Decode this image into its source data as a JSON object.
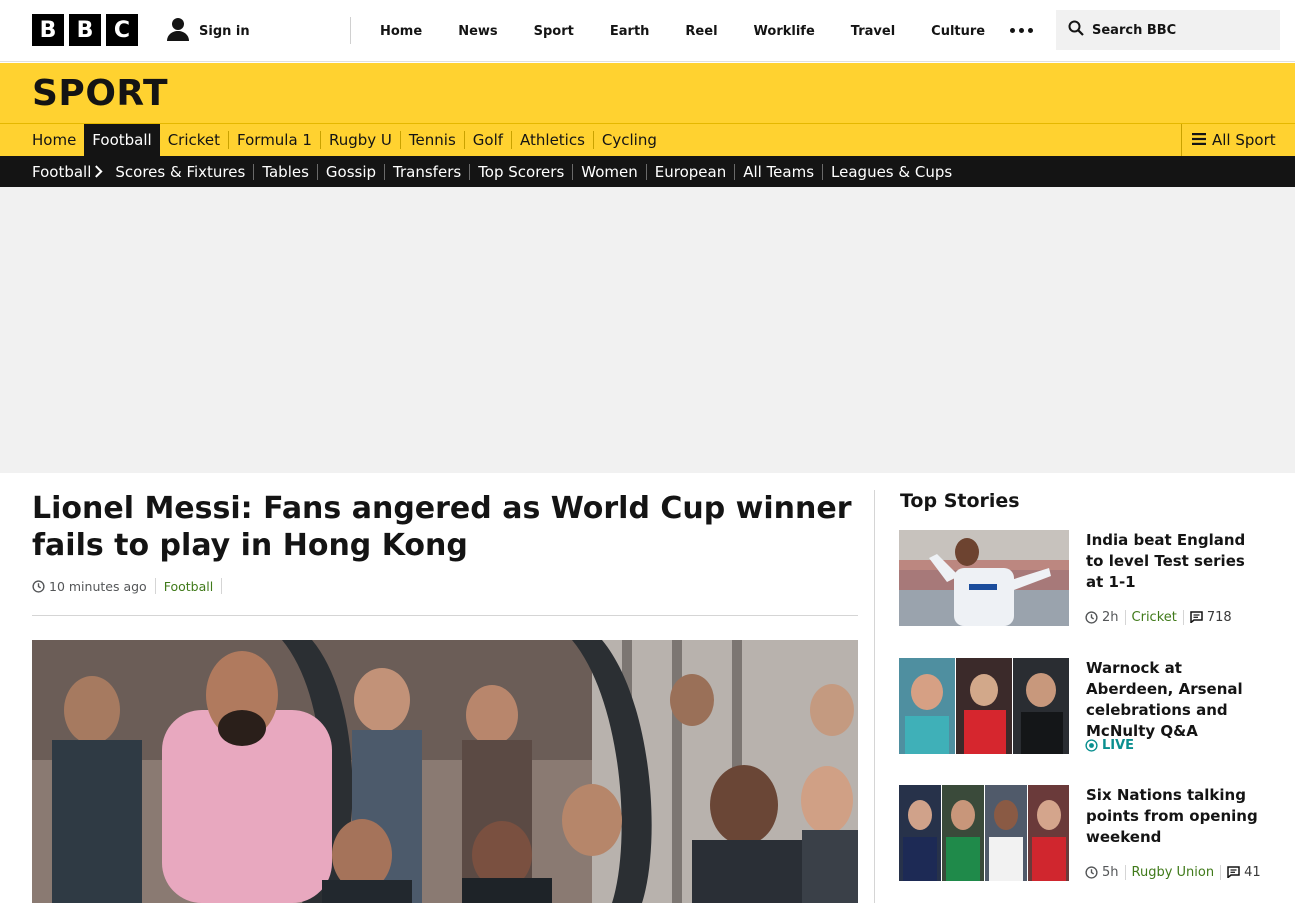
{
  "masthead": {
    "logo_letters": [
      "B",
      "B",
      "C"
    ],
    "signin_label": "Sign in",
    "nav": [
      "Home",
      "News",
      "Sport",
      "Earth",
      "Reel",
      "Worklife",
      "Travel",
      "Culture"
    ],
    "search_placeholder": "Search BBC"
  },
  "sport": {
    "title": "SPORT",
    "nav": [
      {
        "label": "Home",
        "active": false
      },
      {
        "label": "Football",
        "active": true
      },
      {
        "label": "Cricket",
        "active": false
      },
      {
        "label": "Formula 1",
        "active": false
      },
      {
        "label": "Rugby U",
        "active": false
      },
      {
        "label": "Tennis",
        "active": false
      },
      {
        "label": "Golf",
        "active": false
      },
      {
        "label": "Athletics",
        "active": false
      },
      {
        "label": "Cycling",
        "active": false
      }
    ],
    "all_sport_label": "All Sport"
  },
  "subnav": {
    "section": "Football",
    "items": [
      "Scores & Fixtures",
      "Tables",
      "Gossip",
      "Transfers",
      "Top Scorers",
      "Women",
      "European",
      "All Teams",
      "Leagues & Cups"
    ]
  },
  "article": {
    "headline": "Lionel Messi: Fans angered as World Cup winner fails to play in Hong Kong",
    "time": "10 minutes ago",
    "topic": "Football"
  },
  "top_stories": {
    "title": "Top Stories",
    "items": [
      {
        "headline": "India beat England to level Test series at 1-1",
        "time": "2h",
        "topic": "Cricket",
        "comments": "718"
      },
      {
        "headline": "Warnock at Aberdeen, Arsenal celebrations and McNulty Q&A",
        "live_label": "LIVE"
      },
      {
        "headline": "Six Nations talking points from opening weekend",
        "time": "5h",
        "topic": "Rugby Union",
        "comments": "41"
      }
    ]
  },
  "colors": {
    "sport_yellow": "#ffd230",
    "topic_green": "#407a1a",
    "live_teal": "#0a8f8f"
  }
}
